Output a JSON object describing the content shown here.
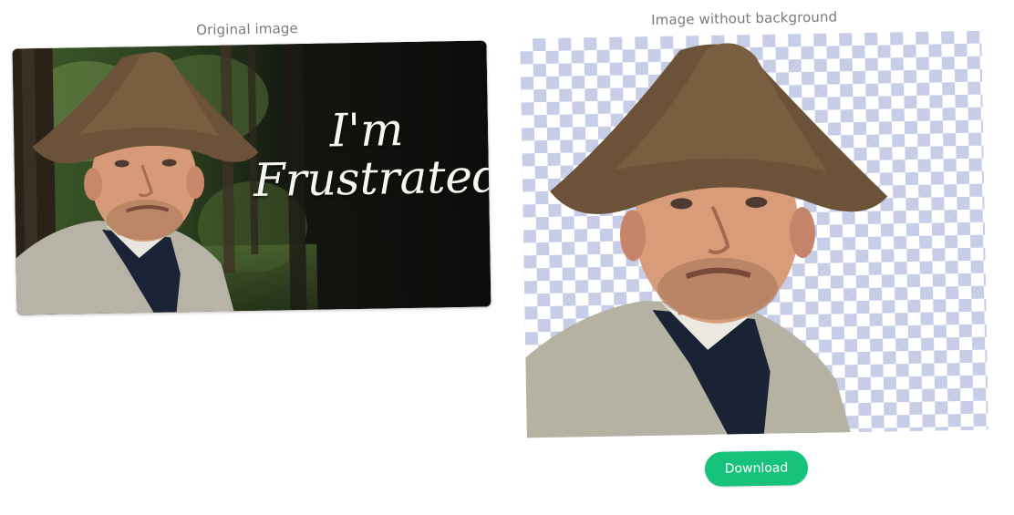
{
  "labels": {
    "original_image": "Original image",
    "image_without_background": "Image without background"
  },
  "original_image": {
    "overlay_line1": "I'm",
    "overlay_line2": "Frustrated"
  },
  "actions": {
    "download_label": "Download"
  },
  "colors": {
    "accent_button": "#17c37b",
    "checker_tile": "#c7cde6",
    "caption_text": "#7a7a7a"
  }
}
